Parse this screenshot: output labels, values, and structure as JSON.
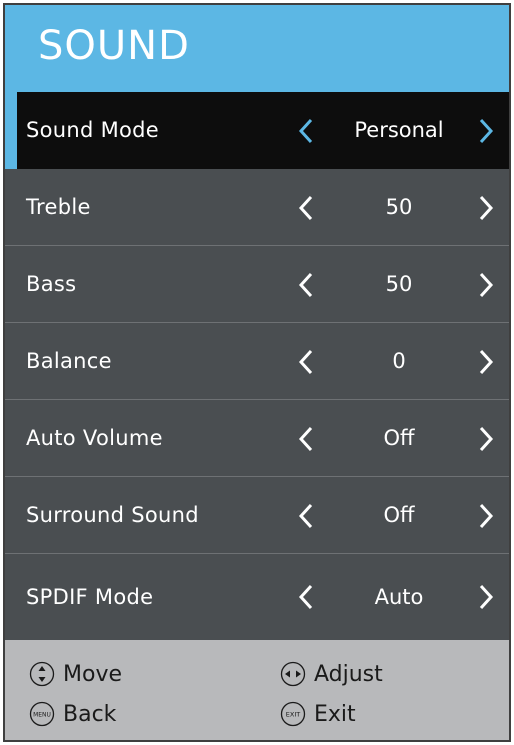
{
  "header": {
    "title": "SOUND"
  },
  "rows": [
    {
      "label": "Sound Mode",
      "value": "Personal",
      "selected": true
    },
    {
      "label": "Treble",
      "value": "50",
      "selected": false
    },
    {
      "label": "Bass",
      "value": "50",
      "selected": false
    },
    {
      "label": "Balance",
      "value": "0",
      "selected": false
    },
    {
      "label": "Auto Volume",
      "value": "Off",
      "selected": false
    },
    {
      "label": "Surround Sound",
      "value": "Off",
      "selected": false
    },
    {
      "label": "SPDIF Mode",
      "value": "Auto",
      "selected": false
    }
  ],
  "footer": {
    "move": {
      "label": "Move",
      "icon": "up-down-icon"
    },
    "adjust": {
      "label": "Adjust",
      "icon": "left-right-icon"
    },
    "back": {
      "label": "Back",
      "icon": "menu-button-icon",
      "icon_text": "MENU"
    },
    "exit": {
      "label": "Exit",
      "icon": "exit-button-icon",
      "icon_text": "EXIT"
    }
  },
  "colors": {
    "accent": "#5cb7e4",
    "row_bg": "#4a4e51",
    "selected_bg": "#0d0d0d",
    "footer_bg": "#b8b9bb"
  }
}
